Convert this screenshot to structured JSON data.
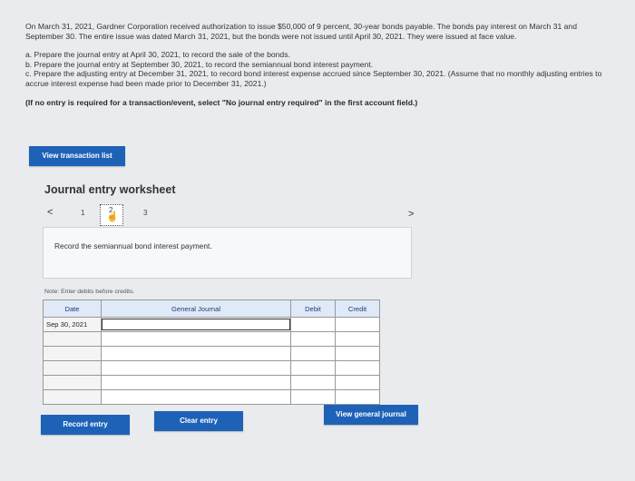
{
  "problem": {
    "intro": "On March 31, 2021, Gardner Corporation received authorization to issue $50,000 of 9 percent, 30-year bonds payable. The bonds pay interest on March 31 and September 30. The entire issue was dated March 31, 2021, but the bonds were not issued until April 30, 2021. They were issued at face value.",
    "part_a": "a. Prepare the journal entry at April 30, 2021, to record the sale of the bonds.",
    "part_b": "b. Prepare the journal entry at September 30, 2021, to record the semiannual bond interest payment.",
    "part_c": "c. Prepare the adjusting entry at December 31, 2021, to record bond interest expense accrued since September 30, 2021. (Assume that no monthly adjusting entries to accrue interest expense had been made prior to December 31, 2021.)",
    "note": "(If no entry is required for a transaction/event, select \"No journal entry required\" in the first account field.)"
  },
  "buttons": {
    "view_transaction_list": "View transaction list",
    "record_entry": "Record entry",
    "clear_entry": "Clear entry",
    "view_general_journal": "View general journal"
  },
  "worksheet": {
    "title": "Journal entry worksheet",
    "pages": [
      "1",
      "2",
      "3"
    ],
    "instruction": "Record the semiannual bond interest payment.",
    "note": "Note: Enter debits before credits."
  },
  "journal": {
    "headers": {
      "date": "Date",
      "account": "General Journal",
      "debit": "Debit",
      "credit": "Credit"
    },
    "rows": [
      {
        "date": "Sep 30, 2021"
      },
      {
        "date": ""
      },
      {
        "date": ""
      },
      {
        "date": ""
      },
      {
        "date": ""
      },
      {
        "date": ""
      }
    ]
  }
}
